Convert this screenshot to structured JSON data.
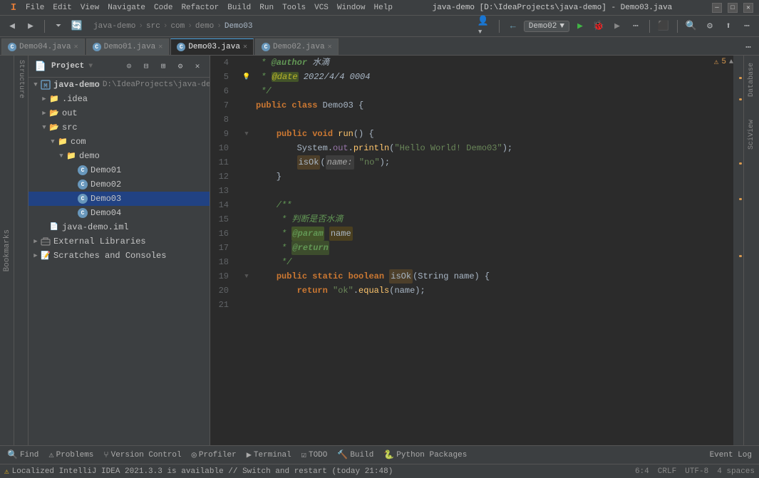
{
  "titleBar": {
    "title": "java-demo [D:\\IdeaProjects\\java-demo] - Demo03.java",
    "menus": [
      "File",
      "Edit",
      "View",
      "Navigate",
      "Code",
      "Refactor",
      "Build",
      "Run",
      "Tools",
      "VCS",
      "Window",
      "Help"
    ]
  },
  "breadcrumb": {
    "parts": [
      "java-demo",
      "src",
      "com",
      "demo",
      "Demo03"
    ]
  },
  "runConfig": {
    "name": "Demo02",
    "dropdown": "▼"
  },
  "tabs": [
    {
      "id": "Demo04",
      "label": "Demo04.java",
      "active": false
    },
    {
      "id": "Demo01",
      "label": "Demo01.java",
      "active": false
    },
    {
      "id": "Demo03",
      "label": "Demo03.java",
      "active": true
    },
    {
      "id": "Demo02",
      "label": "Demo02.java",
      "active": false
    }
  ],
  "sidebar": {
    "title": "Project",
    "tree": [
      {
        "indent": 0,
        "arrow": "▼",
        "icon": "module",
        "label": "java-demo",
        "path": "D:\\IdeaProjects\\java-demo",
        "level": 0
      },
      {
        "indent": 1,
        "arrow": "▶",
        "icon": "folder",
        "label": ".idea",
        "path": "",
        "level": 1
      },
      {
        "indent": 1,
        "arrow": "▶",
        "icon": "folder-out",
        "label": "out",
        "path": "",
        "level": 1
      },
      {
        "indent": 1,
        "arrow": "▼",
        "icon": "folder-src",
        "label": "src",
        "path": "",
        "level": 1
      },
      {
        "indent": 2,
        "arrow": "▼",
        "icon": "folder",
        "label": "com",
        "path": "",
        "level": 2
      },
      {
        "indent": 3,
        "arrow": "▼",
        "icon": "folder",
        "label": "demo",
        "path": "",
        "level": 3
      },
      {
        "indent": 4,
        "arrow": "",
        "icon": "class",
        "label": "Demo01",
        "path": "",
        "level": 4
      },
      {
        "indent": 4,
        "arrow": "",
        "icon": "class",
        "label": "Demo02",
        "path": "",
        "level": 4
      },
      {
        "indent": 4,
        "arrow": "",
        "icon": "class",
        "label": "Demo03",
        "path": "",
        "level": 4,
        "selected": true
      },
      {
        "indent": 4,
        "arrow": "",
        "icon": "class",
        "label": "Demo04",
        "path": "",
        "level": 4
      },
      {
        "indent": 1,
        "arrow": "",
        "icon": "iml",
        "label": "java-demo.iml",
        "path": "",
        "level": 1
      },
      {
        "indent": 0,
        "arrow": "▶",
        "icon": "lib",
        "label": "External Libraries",
        "path": "",
        "level": 0
      },
      {
        "indent": 0,
        "arrow": "▶",
        "icon": "scratch",
        "label": "Scratches and Consoles",
        "path": "",
        "level": 0
      }
    ]
  },
  "editor": {
    "alertCount": "5",
    "lines": [
      {
        "num": "4",
        "content": " * @author 水滴",
        "type": "javadoc"
      },
      {
        "num": "5",
        "content": " * @date 2022/4/4 0004",
        "type": "javadoc",
        "hasBulb": true
      },
      {
        "num": "6",
        "content": " */",
        "type": "javadoc"
      },
      {
        "num": "7",
        "content": "public class Demo03 {",
        "type": "code"
      },
      {
        "num": "8",
        "content": "",
        "type": "blank"
      },
      {
        "num": "9",
        "content": "    public void run() {",
        "type": "code"
      },
      {
        "num": "10",
        "content": "        System.out.println(\"Hello World! Demo03\");",
        "type": "code"
      },
      {
        "num": "11",
        "content": "        isOk( name: \"no\");",
        "type": "code"
      },
      {
        "num": "12",
        "content": "    }",
        "type": "code"
      },
      {
        "num": "13",
        "content": "",
        "type": "blank"
      },
      {
        "num": "14",
        "content": "    /**",
        "type": "javadoc"
      },
      {
        "num": "15",
        "content": "     * 判断是否水滴",
        "type": "javadoc"
      },
      {
        "num": "16",
        "content": "     * @param name",
        "type": "javadoc"
      },
      {
        "num": "17",
        "content": "     * @return",
        "type": "javadoc"
      },
      {
        "num": "18",
        "content": "     */",
        "type": "javadoc"
      },
      {
        "num": "19",
        "content": "    public static boolean isOk(String name) {",
        "type": "code"
      },
      {
        "num": "20",
        "content": "        return \"ok\".equals(name);",
        "type": "code"
      },
      {
        "num": "21",
        "content": "",
        "type": "blank"
      }
    ]
  },
  "bottomTools": [
    {
      "id": "find",
      "icon": "🔍",
      "label": "Find"
    },
    {
      "id": "problems",
      "icon": "⚠",
      "label": "Problems"
    },
    {
      "id": "vcs",
      "icon": "⑂",
      "label": "Version Control"
    },
    {
      "id": "profiler",
      "icon": "◎",
      "label": "Profiler"
    },
    {
      "id": "terminal",
      "icon": "▶",
      "label": "Terminal"
    },
    {
      "id": "todo",
      "icon": "☑",
      "label": "TODO"
    },
    {
      "id": "build",
      "icon": "🔨",
      "label": "Build"
    },
    {
      "id": "python",
      "icon": "🐍",
      "label": "Python Packages"
    }
  ],
  "bottomRight": {
    "eventLog": "Event Log"
  },
  "statusBar": {
    "message": "Localized IntelliJ IDEA 2021.3.3 is available // Switch and restart (today 21:48)",
    "position": "6:4",
    "lineEnding": "CRLF",
    "encoding": "UTF-8",
    "indent": "4 spaces"
  }
}
